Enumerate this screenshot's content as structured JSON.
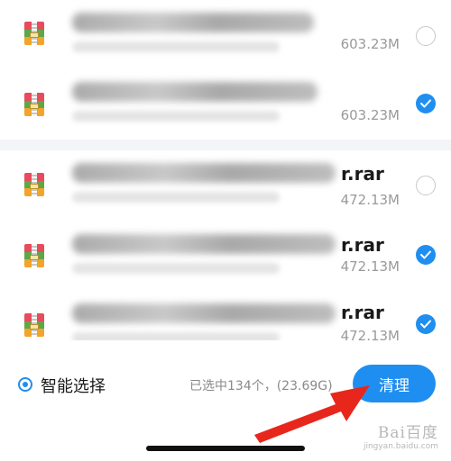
{
  "files": [
    {
      "ext_visible": "",
      "size": "603.23M",
      "checked": false
    },
    {
      "ext_visible": "",
      "size": "603.23M",
      "checked": true
    },
    {
      "ext_visible": "r.rar",
      "size": "472.13M",
      "checked": false
    },
    {
      "ext_visible": "r.rar",
      "size": "472.13M",
      "checked": true
    },
    {
      "ext_visible": "r.rar",
      "size": "472.13M",
      "checked": true
    }
  ],
  "bottom_bar": {
    "smart_select_label": "智能选择",
    "selected_info": "已选中134个，(23.69G)",
    "clean_button": "清理"
  },
  "watermark": {
    "text": "Bai百度",
    "sub": "jingyan.baidu.com"
  },
  "colors": {
    "accent": "#1f8ef1",
    "annotation_arrow": "#e8271c"
  },
  "icons": [
    "rar-archive-icon",
    "check-icon",
    "arrow-annotation"
  ]
}
